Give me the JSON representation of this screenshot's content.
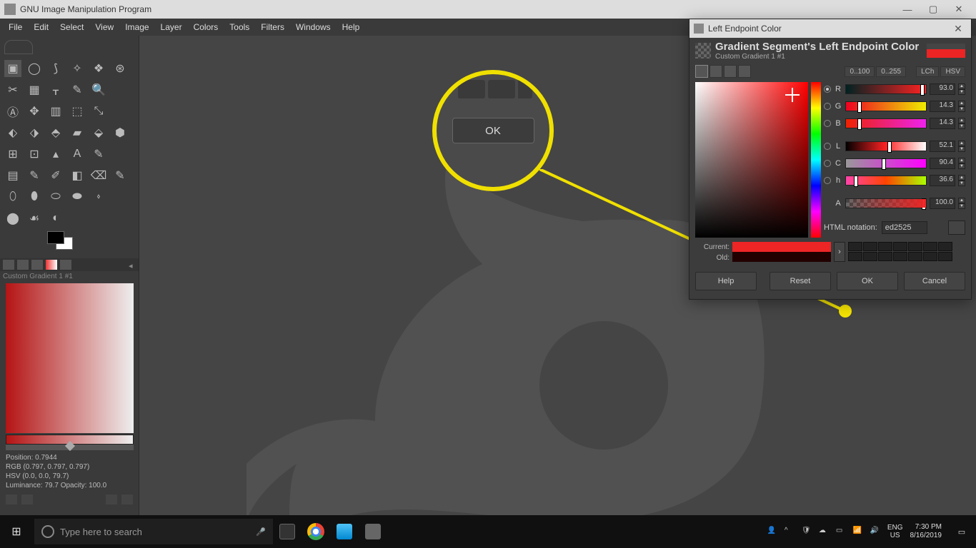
{
  "window": {
    "title": "GNU Image Manipulation Program"
  },
  "menu": [
    "File",
    "Edit",
    "Select",
    "View",
    "Image",
    "Layer",
    "Colors",
    "Tools",
    "Filters",
    "Windows",
    "Help"
  ],
  "gradient": {
    "title": "Custom Gradient 1 #1",
    "info": {
      "position": "Position: 0.7944",
      "rgb": "RGB (0.797, 0.797, 0.797)",
      "hsv": "HSV (0.0, 0.0, 79.7)",
      "lum": "Luminance: 79.7   Opacity: 100.0"
    }
  },
  "zoom": {
    "ok": "OK"
  },
  "dialog": {
    "title": "Left Endpoint Color",
    "heading": "Gradient Segment's Left Endpoint Color",
    "sub": "Custom Gradient 1 #1",
    "ranges": {
      "r0100": "0..100",
      "r0255": "0..255",
      "lch": "LCh",
      "hsv": "HSV"
    },
    "channels": {
      "R": "93.0",
      "G": "14.3",
      "B": "14.3",
      "L": "52.1",
      "C": "90.4",
      "h": "36.6",
      "A": "100.0"
    },
    "html_label": "HTML notation:",
    "html_value": "ed2525",
    "current_label": "Current:",
    "old_label": "Old:",
    "buttons": {
      "help": "Help",
      "reset": "Reset",
      "ok": "OK",
      "cancel": "Cancel"
    }
  },
  "taskbar": {
    "search_placeholder": "Type here to search",
    "lang1": "ENG",
    "lang2": "US",
    "time": "7:30 PM",
    "date": "8/16/2019"
  },
  "labels": {
    "R": "R",
    "G": "G",
    "B": "B",
    "L": "L",
    "C": "C",
    "h": "h",
    "A": "A"
  }
}
